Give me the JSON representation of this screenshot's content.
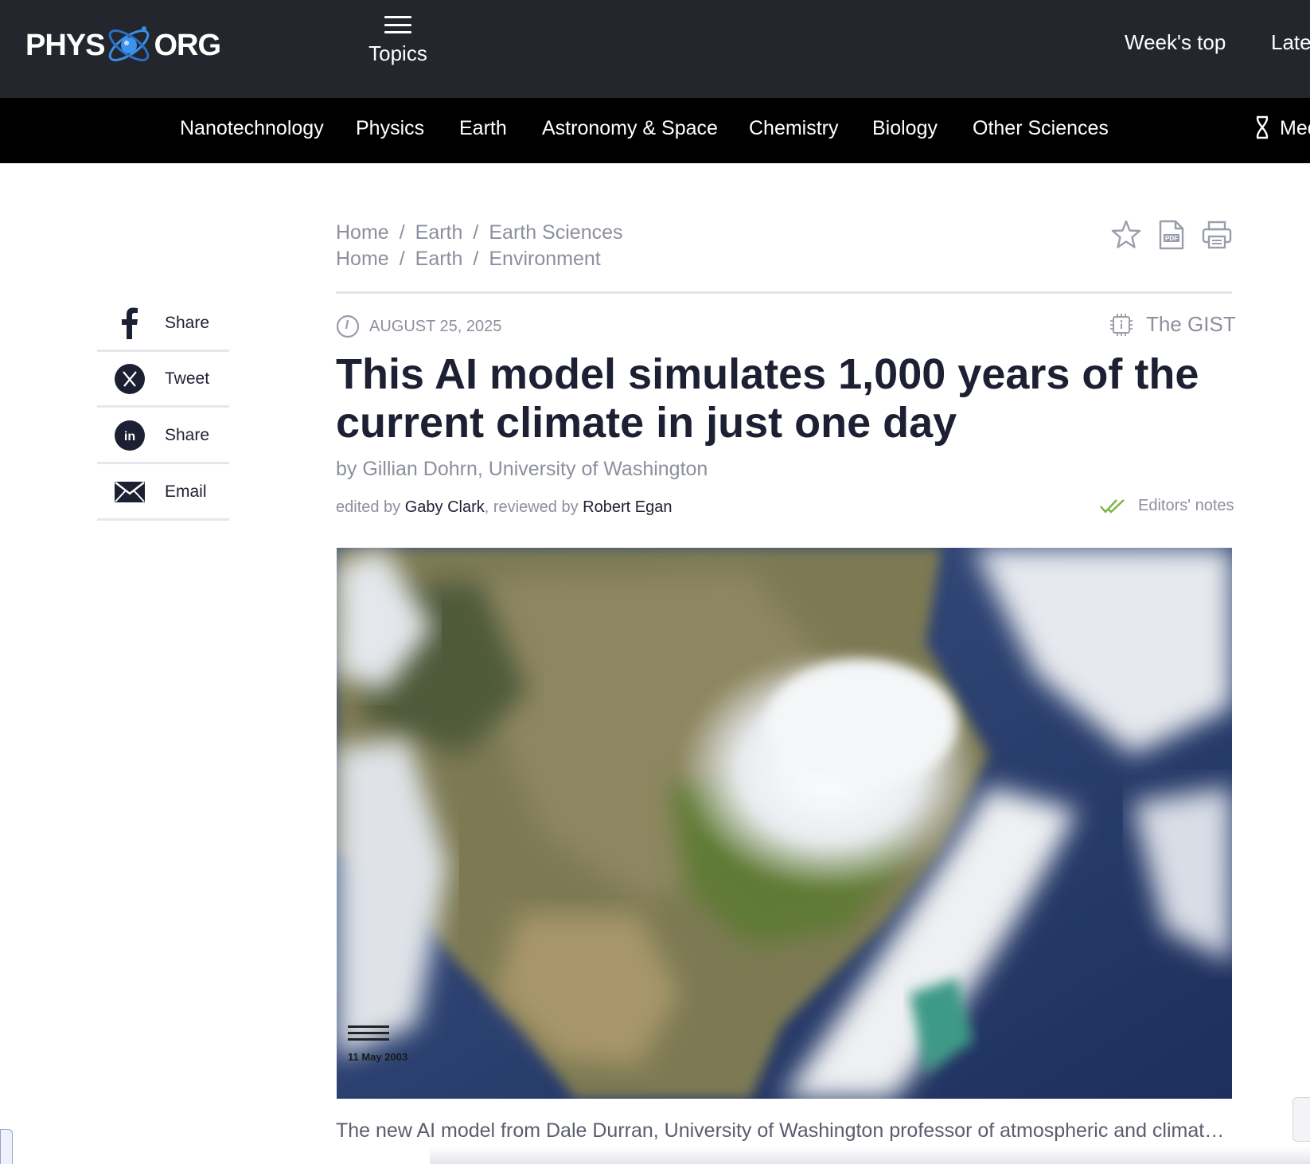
{
  "header": {
    "logo_left": "PHYS",
    "logo_right": "ORG",
    "topics_label": "Topics",
    "weeks_top": "Week's top",
    "latest": "Late"
  },
  "nav": {
    "items": [
      "Nanotechnology",
      "Physics",
      "Earth",
      "Astronomy & Space",
      "Chemistry",
      "Biology",
      "Other Sciences"
    ],
    "partial": "Med"
  },
  "share": {
    "facebook": "Share",
    "twitter": "Tweet",
    "linkedin": "Share",
    "email": "Email"
  },
  "breadcrumbs": [
    [
      "Home",
      "Earth",
      "Earth Sciences"
    ],
    [
      "Home",
      "Earth",
      "Environment"
    ]
  ],
  "breadcrumb_separator": "/",
  "article": {
    "date": "AUGUST 25, 2025",
    "gist_label": "The GIST",
    "title": "This AI model simulates 1,000 years of the current climate in just one day",
    "byline_prefix": "by",
    "author": "Gillian Dohrn, University of Washington",
    "edited_prefix": "edited by",
    "editor": "Gaby Clark",
    "reviewed_prefix": ", reviewed by",
    "reviewer": "Robert Egan",
    "editors_notes": "Editors' notes",
    "image_stamp": "11  May  2003",
    "caption": "The new AI model from Dale Durran, University of Washington professor of atmospheric and climate sci..."
  },
  "colors": {
    "topbar": "#23262d",
    "navbar": "#000000",
    "muted_text": "#8c8f9e",
    "headline": "#1d2033",
    "check_green": "#7cb342"
  }
}
